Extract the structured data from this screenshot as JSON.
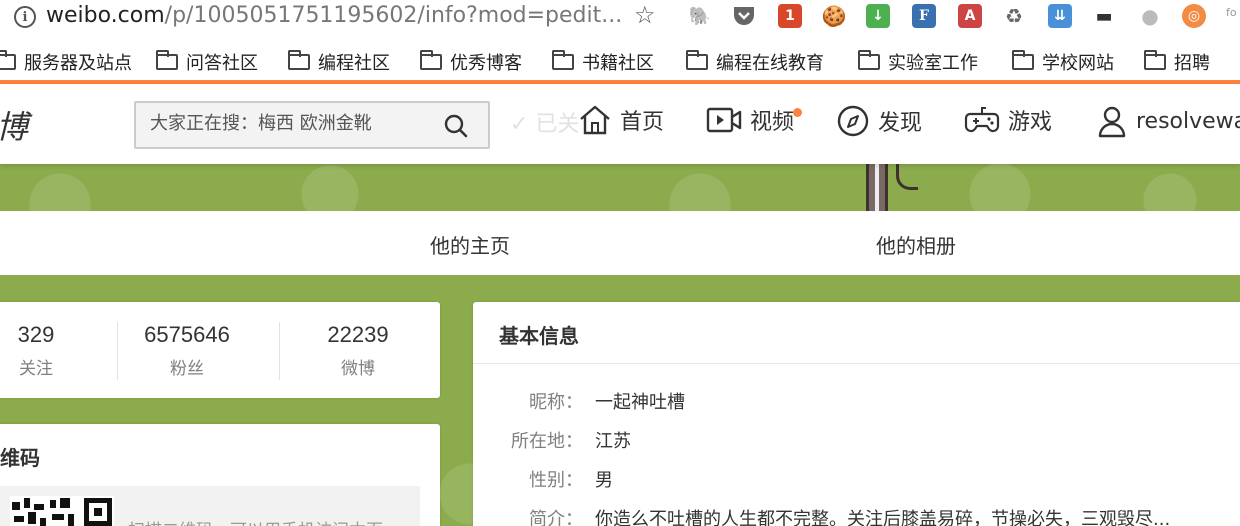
{
  "browser": {
    "url_main": "weibo.com",
    "url_rest": "/p/1005051751195602/info?mod=pedit...",
    "extensions_more": "fo"
  },
  "bookmarks": [
    "服务器及站点",
    "问答社区",
    "编程社区",
    "优秀博客",
    "书籍社区",
    "编程在线教育",
    "实验室工作",
    "学校网站",
    "招聘"
  ],
  "header": {
    "logo_fragment": "博",
    "search_placeholder": "大家正在搜：梅西 欧洲金靴",
    "ghost_text": "✓ 已关",
    "nav": {
      "home": "首页",
      "video": "视频",
      "discover": "发现",
      "games": "游戏",
      "user": "resolvewar"
    }
  },
  "profile_tabs": {
    "home": "他的主页",
    "album": "他的相册"
  },
  "counts": [
    {
      "num": "329",
      "label": "关注"
    },
    {
      "num": "6575646",
      "label": "粉丝"
    },
    {
      "num": "22239",
      "label": "微博"
    }
  ],
  "qr": {
    "title": "维码",
    "text": "扫描二维码，可以用手机访问本页"
  },
  "basic_info": {
    "title": "基本信息",
    "rows": [
      {
        "key": "昵称：",
        "value": "一起神吐槽"
      },
      {
        "key": "所在地：",
        "value": "江苏"
      },
      {
        "key": "性别：",
        "value": "男"
      },
      {
        "key": "简介：",
        "value": "你造么不吐槽的人生都不完整。关注后膝盖易碎，节操必失，三观毁尽..."
      }
    ]
  },
  "colors": {
    "accent": "#ff8140",
    "banner_green": "#8bab4c"
  }
}
